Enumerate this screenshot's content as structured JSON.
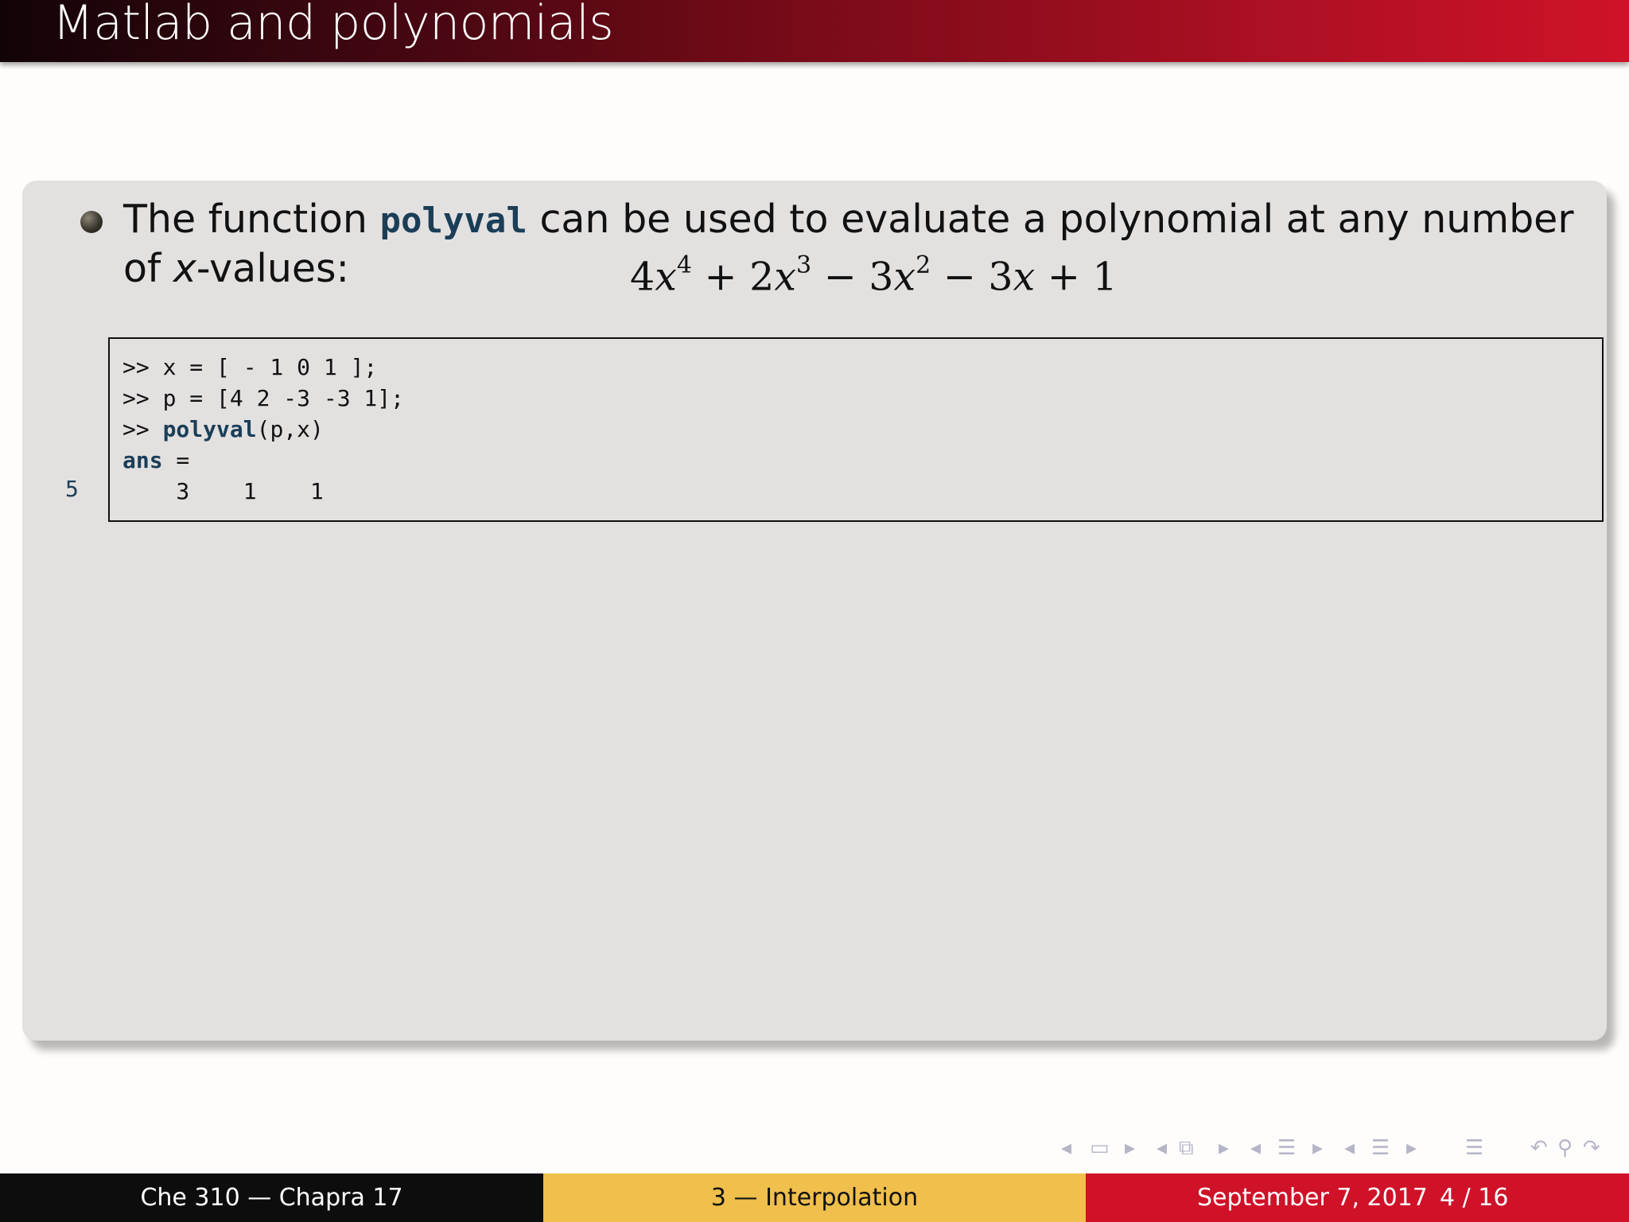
{
  "slide": {
    "title": "Matlab and polynomials",
    "bullet": {
      "text_before": "The function ",
      "keyword": "polyval",
      "text_after": " can be used to evaluate a polynomial at any number",
      "line2_prefix": "of ",
      "line2_var": "x",
      "line2_suffix": "-values:"
    },
    "formula": {
      "t1_coef": "4",
      "t1_var": "x",
      "t1_exp": "4",
      "op1": " + ",
      "t2_coef": "2",
      "t2_var": "x",
      "t2_exp": "3",
      "op2": " − ",
      "t3_coef": "3",
      "t3_var": "x",
      "t3_exp": "2",
      "op3": " − ",
      "t4_coef": "3",
      "t4_var": "x",
      "op4": " + ",
      "t5": "1"
    },
    "code": {
      "line1": ">> x = [ - 1 0 1 ];",
      "line2": ">> p = [4 2 -3 -3 1];",
      "line3_prompt": ">> ",
      "line3_kw": "polyval",
      "line3_args": "(p,x)",
      "line4_kw": "ans",
      "line4_rest": " =",
      "line5": "    3    1    1",
      "line_number": "5"
    }
  },
  "navigation": {
    "icons": [
      "nav-left-arrow",
      "frame-icon",
      "nav-right-arrow",
      "nav-left-arrow",
      "slides-icon",
      "nav-right-arrow",
      "nav-left-arrow",
      "section-icon",
      "nav-right-arrow",
      "nav-left-arrow",
      "subsection-icon",
      "nav-right-arrow",
      "toc-icon",
      "undo-icon",
      "search-icon",
      "redo-icon"
    ]
  },
  "footer": {
    "author": "Che 310 — Chapra 17",
    "section": "3 — Interpolation",
    "date": "September 7, 2017",
    "page": "4 / 16"
  }
}
